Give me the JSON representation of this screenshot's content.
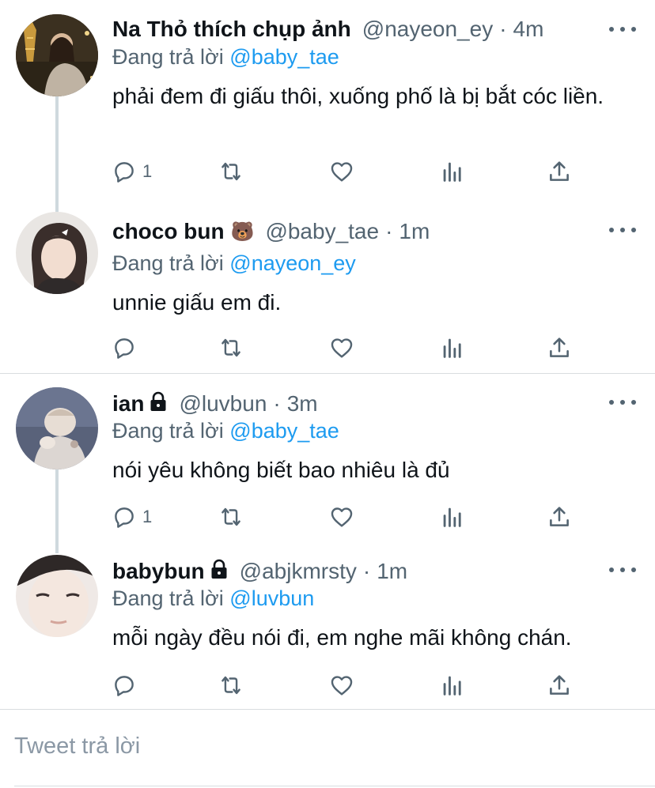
{
  "reply_prefix": "Đang trả lời",
  "colors": {
    "accent": "#1d9bf0",
    "text": "#0f1419",
    "secondary": "#536471",
    "divider": "#d9dde0"
  },
  "tweets": [
    {
      "name": "Na Thỏ thích chụp ảnh",
      "handle": "@nayeon_ey",
      "time": "4m",
      "reply_to": "@baby_tae",
      "text": "phải đem đi giấu thôi, xuống phố là bị bắt cóc liền.",
      "reply_count": "1",
      "badge": ""
    },
    {
      "name": "choco bun",
      "handle": "@baby_tae",
      "time": "1m",
      "reply_to": "@nayeon_ey",
      "text": "unnie giấu em đi.",
      "reply_count": "",
      "badge": "🐻"
    },
    {
      "name": "ian",
      "handle": "@luvbun",
      "time": "3m",
      "reply_to": "@baby_tae",
      "text": "nói yêu không biết bao nhiêu là đủ",
      "reply_count": "1",
      "badge": "lock-icon"
    },
    {
      "name": "babybun",
      "handle": "@abjkmrsty",
      "time": "1m",
      "reply_to": "@luvbun",
      "text": "mỗi ngày đều nói đi, em nghe mãi không chán.",
      "reply_count": "",
      "badge": "lock-icon"
    }
  ],
  "composer": {
    "placeholder": "Tweet trả lời"
  }
}
